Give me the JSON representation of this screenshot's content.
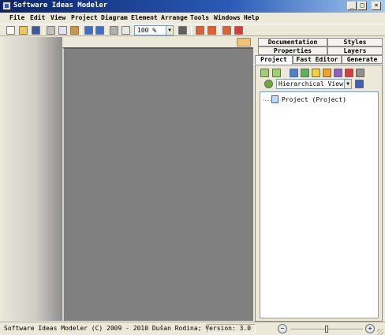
{
  "window": {
    "title": "Software Ideas Modeler",
    "controls": {
      "minimize": "_",
      "maximize": "□",
      "close": "×"
    }
  },
  "menu": {
    "items": [
      "File",
      "Edit",
      "View",
      "Project",
      "Diagram",
      "Element",
      "Arrange",
      "Tools",
      "Windows",
      "Help"
    ]
  },
  "toolbar": {
    "zoom_value": "100 %",
    "zoom_arrow": "▼",
    "icons": [
      "new-icon",
      "open-icon",
      "save-icon",
      "cut-icon",
      "copy-icon",
      "paste-icon",
      "undo-icon",
      "redo-icon",
      "print-icon",
      "print-preview-icon",
      "grid-icon",
      "export-icon",
      "import-icon",
      "diagram-export-icon",
      "diagram-import-icon"
    ]
  },
  "right_panel": {
    "tabs_row1": [
      "Documentation",
      "Styles"
    ],
    "tabs_row2": [
      "Properties",
      "Layers"
    ],
    "tabs_row3": [
      "Project",
      "Fast Editor",
      "Generate"
    ],
    "active_tab": "Project",
    "view_select": "Hierarchical View",
    "view_arrow": "▼",
    "tree": [
      {
        "label": "Project (Project)"
      }
    ]
  },
  "status": {
    "text": "Software Ideas Modeler (C) 2009 - 2010 Dušan Rodina; Version: 3.0",
    "zoom_out": "−",
    "zoom_in": "+",
    "zoom_level": 0.5
  },
  "colors": {
    "title_start": "#0a246a",
    "title_end": "#a6caf0",
    "canvas": "#808080",
    "chrome": "#ece9d8"
  }
}
